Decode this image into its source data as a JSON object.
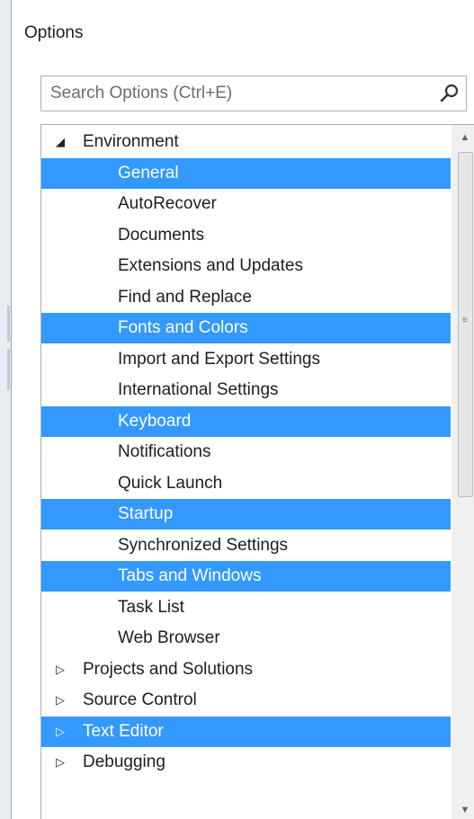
{
  "window": {
    "title": "Options"
  },
  "search": {
    "placeholder": "Search Options (Ctrl+E)",
    "icon": "search-icon"
  },
  "colors": {
    "selection": "#3399ff",
    "selection_text": "#ffffff",
    "text": "#1e1e1e",
    "border": "#a8b0bc"
  },
  "tree": {
    "expanded_glyph": "◢",
    "collapsed_glyph": "▷",
    "items": [
      {
        "label": "Environment",
        "level": 0,
        "expanded": true,
        "selected": false,
        "name": "tree-node-environment"
      },
      {
        "label": "General",
        "level": 1,
        "selected": true,
        "name": "tree-item-general"
      },
      {
        "label": "AutoRecover",
        "level": 1,
        "selected": false,
        "name": "tree-item-autorecover"
      },
      {
        "label": "Documents",
        "level": 1,
        "selected": false,
        "name": "tree-item-documents"
      },
      {
        "label": "Extensions and Updates",
        "level": 1,
        "selected": false,
        "name": "tree-item-extensions-and-updates"
      },
      {
        "label": "Find and Replace",
        "level": 1,
        "selected": false,
        "name": "tree-item-find-and-replace"
      },
      {
        "label": "Fonts and Colors",
        "level": 1,
        "selected": true,
        "name": "tree-item-fonts-and-colors"
      },
      {
        "label": "Import and Export Settings",
        "level": 1,
        "selected": false,
        "name": "tree-item-import-export-settings"
      },
      {
        "label": "International Settings",
        "level": 1,
        "selected": false,
        "name": "tree-item-international-settings"
      },
      {
        "label": "Keyboard",
        "level": 1,
        "selected": true,
        "name": "tree-item-keyboard"
      },
      {
        "label": "Notifications",
        "level": 1,
        "selected": false,
        "name": "tree-item-notifications"
      },
      {
        "label": "Quick Launch",
        "level": 1,
        "selected": false,
        "name": "tree-item-quick-launch"
      },
      {
        "label": "Startup",
        "level": 1,
        "selected": true,
        "name": "tree-item-startup"
      },
      {
        "label": "Synchronized Settings",
        "level": 1,
        "selected": false,
        "name": "tree-item-synchronized-settings"
      },
      {
        "label": "Tabs and Windows",
        "level": 1,
        "selected": true,
        "name": "tree-item-tabs-and-windows"
      },
      {
        "label": "Task List",
        "level": 1,
        "selected": false,
        "name": "tree-item-task-list"
      },
      {
        "label": "Web Browser",
        "level": 1,
        "selected": false,
        "name": "tree-item-web-browser"
      },
      {
        "label": "Projects and Solutions",
        "level": 0,
        "expanded": false,
        "selected": false,
        "name": "tree-node-projects-and-solutions"
      },
      {
        "label": "Source Control",
        "level": 0,
        "expanded": false,
        "selected": false,
        "name": "tree-node-source-control"
      },
      {
        "label": "Text Editor",
        "level": 0,
        "expanded": false,
        "selected": true,
        "name": "tree-node-text-editor"
      },
      {
        "label": "Debugging",
        "level": 0,
        "expanded": false,
        "selected": false,
        "name": "tree-node-debugging"
      }
    ]
  },
  "scrollbar": {
    "up_glyph": "▲",
    "down_glyph": "▼",
    "grip_glyph": "≡"
  }
}
